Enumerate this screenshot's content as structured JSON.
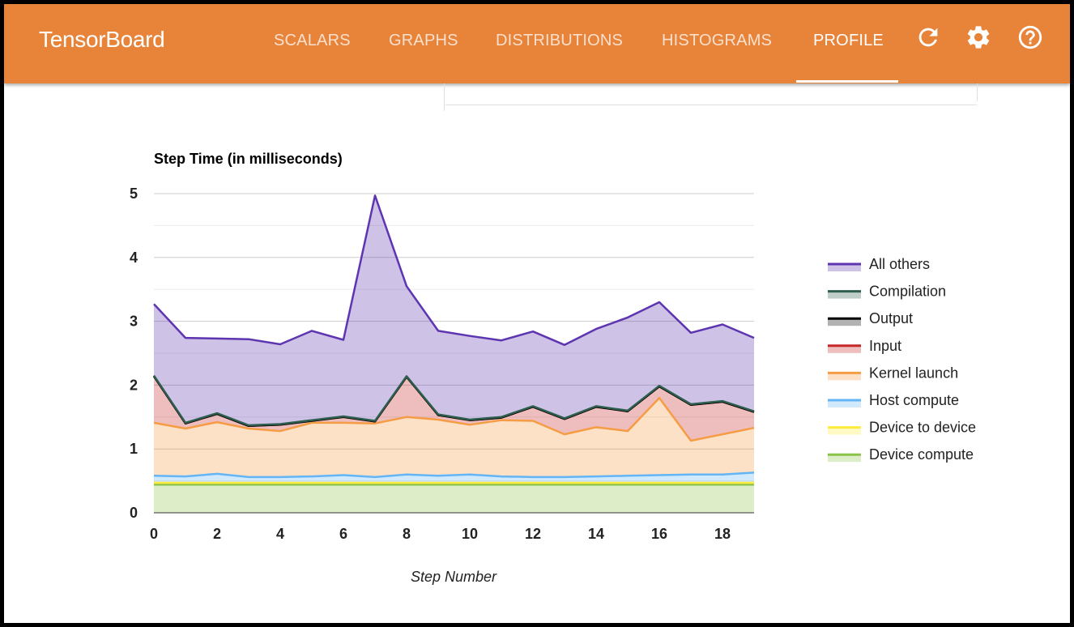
{
  "header": {
    "brand": "TensorBoard",
    "tabs": [
      {
        "label": "SCALARS",
        "active": false
      },
      {
        "label": "GRAPHS",
        "active": false
      },
      {
        "label": "DISTRIBUTIONS",
        "active": false
      },
      {
        "label": "HISTOGRAMS",
        "active": false
      },
      {
        "label": "PROFILE",
        "active": true
      }
    ],
    "icons": [
      "refresh-icon",
      "gear-icon",
      "help-icon"
    ],
    "color": "#e8843a"
  },
  "chart_data": {
    "type": "area",
    "stacked": true,
    "title": "Step Time (in milliseconds)",
    "xlabel": "Step Number",
    "ylabel": "",
    "xlim": [
      0,
      19
    ],
    "ylim": [
      0,
      5
    ],
    "x_ticks": [
      0,
      2,
      4,
      6,
      8,
      10,
      12,
      14,
      16,
      18
    ],
    "y_ticks": [
      0,
      1,
      2,
      3,
      4,
      5
    ],
    "grid": true,
    "legend_position": "right",
    "x": [
      0,
      1,
      2,
      3,
      4,
      5,
      6,
      7,
      8,
      9,
      10,
      11,
      12,
      13,
      14,
      15,
      16,
      17,
      18,
      19
    ],
    "series": [
      {
        "name": "Device compute",
        "color": "#8bc34a",
        "values": [
          0.44,
          0.44,
          0.44,
          0.44,
          0.44,
          0.44,
          0.44,
          0.44,
          0.44,
          0.44,
          0.44,
          0.44,
          0.44,
          0.44,
          0.44,
          0.44,
          0.44,
          0.44,
          0.44,
          0.44
        ]
      },
      {
        "name": "Device to device",
        "color": "#ffeb3b",
        "values": [
          0.03,
          0.03,
          0.03,
          0.03,
          0.03,
          0.03,
          0.03,
          0.03,
          0.03,
          0.03,
          0.03,
          0.03,
          0.03,
          0.03,
          0.03,
          0.03,
          0.03,
          0.03,
          0.03,
          0.03
        ]
      },
      {
        "name": "Host compute",
        "color": "#64b5f6",
        "values": [
          0.11,
          0.1,
          0.14,
          0.09,
          0.09,
          0.1,
          0.12,
          0.09,
          0.13,
          0.11,
          0.13,
          0.1,
          0.09,
          0.09,
          0.1,
          0.11,
          0.12,
          0.13,
          0.13,
          0.16
        ]
      },
      {
        "name": "Kernel launch",
        "color": "#f59c45",
        "values": [
          0.83,
          0.75,
          0.81,
          0.76,
          0.72,
          0.84,
          0.82,
          0.84,
          0.9,
          0.88,
          0.78,
          0.88,
          0.88,
          0.67,
          0.77,
          0.7,
          1.21,
          0.53,
          0.63,
          0.7
        ]
      },
      {
        "name": "Input",
        "color": "#c62828",
        "values": [
          0.73,
          0.08,
          0.13,
          0.04,
          0.1,
          0.03,
          0.09,
          0.03,
          0.63,
          0.07,
          0.07,
          0.04,
          0.22,
          0.24,
          0.32,
          0.31,
          0.18,
          0.56,
          0.51,
          0.25
        ]
      },
      {
        "name": "Output",
        "color": "#000000",
        "values": [
          0.0,
          0.0,
          0.0,
          0.0,
          0.0,
          0.0,
          0.0,
          0.0,
          0.0,
          0.0,
          0.0,
          0.0,
          0.0,
          0.0,
          0.0,
          0.0,
          0.0,
          0.0,
          0.0,
          0.0
        ]
      },
      {
        "name": "Compilation",
        "color": "#2e5e4e",
        "values": [
          0.01,
          0.01,
          0.01,
          0.01,
          0.01,
          0.01,
          0.01,
          0.01,
          0.01,
          0.01,
          0.01,
          0.01,
          0.01,
          0.01,
          0.01,
          0.01,
          0.01,
          0.01,
          0.01,
          0.01
        ]
      },
      {
        "name": "All others",
        "color": "#5e35b1",
        "values": [
          1.12,
          1.33,
          1.17,
          1.35,
          1.25,
          1.4,
          1.2,
          3.53,
          1.41,
          1.31,
          1.31,
          1.2,
          1.17,
          1.15,
          1.21,
          1.46,
          1.31,
          1.12,
          1.2,
          1.15
        ]
      }
    ]
  }
}
